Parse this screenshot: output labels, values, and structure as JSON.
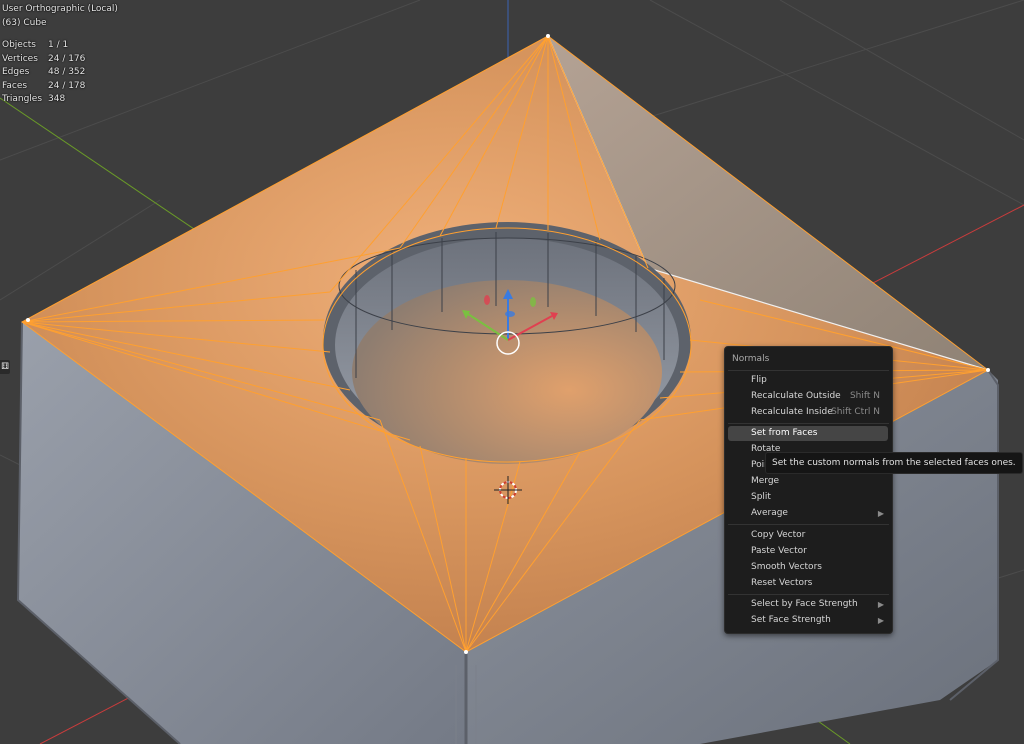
{
  "viewport": {
    "view_name": "User Orthographic (Local)",
    "object_name": "(63) Cube"
  },
  "stats": [
    {
      "label": "Objects",
      "value": "1 / 1"
    },
    {
      "label": "Vertices",
      "value": "24 / 176"
    },
    {
      "label": "Edges",
      "value": "48 / 352"
    },
    {
      "label": "Faces",
      "value": "24 / 178"
    },
    {
      "label": "Triangles",
      "value": "348"
    }
  ],
  "menu": {
    "title": "Normals",
    "items": [
      {
        "label": "Flip",
        "shortcut": ""
      },
      {
        "label": "Recalculate Outside",
        "shortcut": "Shift N"
      },
      {
        "label": "Recalculate Inside",
        "shortcut": "Shift Ctrl N"
      },
      {
        "label": "Set from Faces",
        "shortcut": "",
        "active": true
      },
      {
        "label": "Rotate",
        "shortcut": ""
      },
      {
        "label": "Point to Target",
        "shortcut": ""
      },
      {
        "label": "Merge",
        "shortcut": ""
      },
      {
        "label": "Split",
        "shortcut": ""
      },
      {
        "label": "Average",
        "shortcut": "",
        "submenu": true
      },
      {
        "label": "Copy Vector",
        "shortcut": ""
      },
      {
        "label": "Paste Vector",
        "shortcut": ""
      },
      {
        "label": "Smooth Vectors",
        "shortcut": ""
      },
      {
        "label": "Reset Vectors",
        "shortcut": ""
      },
      {
        "label": "Select by Face Strength",
        "shortcut": "",
        "submenu": true
      },
      {
        "label": "Set Face Strength",
        "shortcut": "",
        "submenu": true
      }
    ]
  },
  "tooltip": {
    "text": "Set the custom normals from the selected faces ones."
  },
  "colors": {
    "background": "#3d3d3d",
    "selected_face": "#e8a468",
    "selected_edge": "#ffa030",
    "side_face": "#8a8f99",
    "menu_bg": "#1d1d1d",
    "axis_x": "#c83c3c",
    "axis_y": "#6a9a28",
    "axis_z": "#3a64b4"
  },
  "icons": {
    "gizmo": "transform-gizmo-icon",
    "cursor": "3d-cursor-icon",
    "side": "dice-icon"
  }
}
